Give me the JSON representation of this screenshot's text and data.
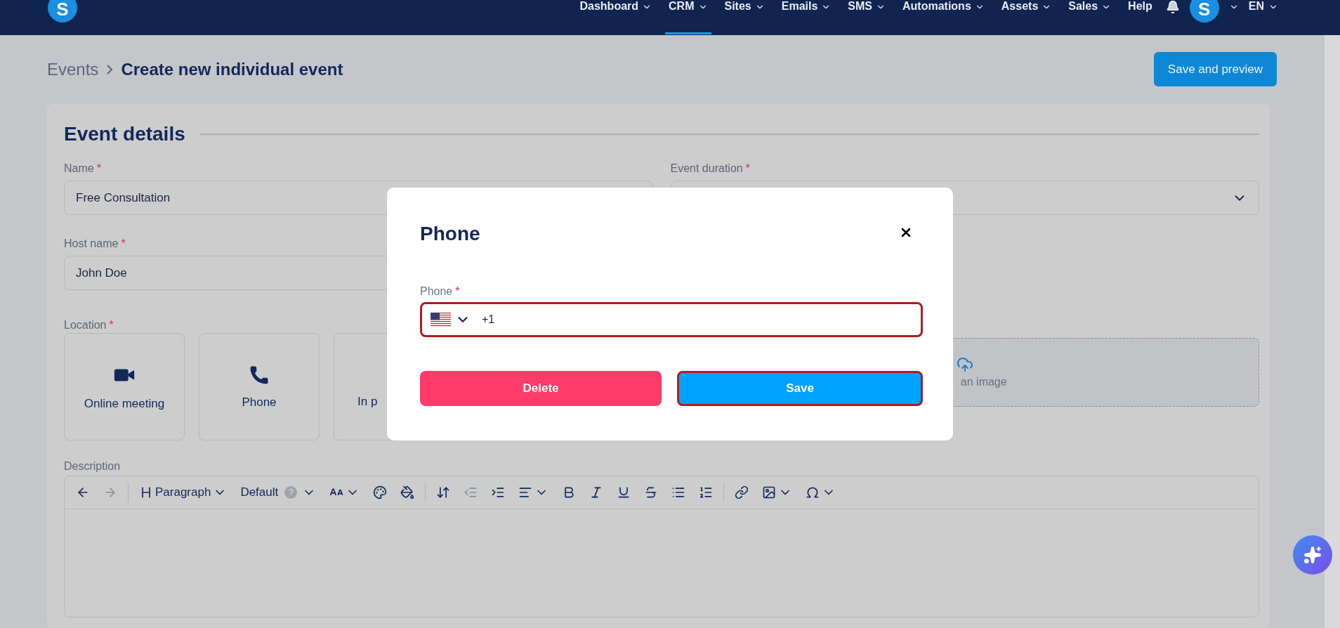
{
  "nav": {
    "logo": "S",
    "items": [
      {
        "label": "Dashboard",
        "selected": false,
        "dropdown": true
      },
      {
        "label": "CRM",
        "selected": true,
        "dropdown": true
      },
      {
        "label": "Sites",
        "selected": false,
        "dropdown": true
      },
      {
        "label": "Emails",
        "selected": false,
        "dropdown": true
      },
      {
        "label": "SMS",
        "selected": false,
        "dropdown": true
      },
      {
        "label": "Automations",
        "selected": false,
        "dropdown": true
      },
      {
        "label": "Assets",
        "selected": false,
        "dropdown": true
      },
      {
        "label": "Sales",
        "selected": false,
        "dropdown": true
      },
      {
        "label": "Help",
        "selected": false,
        "dropdown": false
      }
    ],
    "avatar": "S",
    "language": "EN"
  },
  "breadcrumb": {
    "parent": "Events",
    "current": "Create new individual event"
  },
  "save_preview_button": "Save and preview",
  "section_title": "Event details",
  "fields": [
    {
      "label": "Name",
      "required_mark": "*",
      "kind": "text",
      "value": "Free Consultation"
    },
    {
      "label": "Event duration",
      "required_mark": "*",
      "kind": "select"
    },
    {
      "label": "Host name",
      "required_mark": "*",
      "kind": "text",
      "value": "John Doe"
    }
  ],
  "location": {
    "label": "Location",
    "required_mark": "*",
    "options": [
      {
        "label": "Online meeting"
      },
      {
        "label": "Phone"
      },
      {
        "label": "In p"
      }
    ]
  },
  "image_upload": {
    "text": "an image"
  },
  "description": {
    "label": "Description",
    "toolbar": [
      {
        "kind": "icon",
        "disabled": false,
        "dropdown": false
      },
      {
        "kind": "icon",
        "disabled": true,
        "dropdown": false
      },
      {
        "kind": "divider"
      },
      {
        "kind": "text",
        "label": "Paragraph",
        "dropdown": true
      },
      {
        "kind": "text",
        "label": "Default",
        "badge": "?",
        "dropdown": true
      },
      {
        "kind": "icon",
        "disabled": false,
        "dropdown": true
      },
      {
        "kind": "icon",
        "disabled": false,
        "dropdown": false
      },
      {
        "kind": "icon",
        "disabled": false,
        "dropdown": false
      },
      {
        "kind": "divider"
      },
      {
        "kind": "icon",
        "disabled": false,
        "dropdown": false
      },
      {
        "kind": "icon",
        "disabled": true,
        "dropdown": false
      },
      {
        "kind": "icon",
        "disabled": false,
        "dropdown": false
      },
      {
        "kind": "icon",
        "disabled": false,
        "dropdown": true
      },
      {
        "kind": "icon",
        "disabled": false,
        "dropdown": false
      },
      {
        "kind": "icon",
        "disabled": false,
        "dropdown": false
      },
      {
        "kind": "icon",
        "disabled": false,
        "dropdown": false
      },
      {
        "kind": "icon",
        "disabled": false,
        "dropdown": false
      },
      {
        "kind": "icon",
        "disabled": false,
        "dropdown": false
      },
      {
        "kind": "icon",
        "disabled": false,
        "dropdown": false
      },
      {
        "kind": "divider"
      },
      {
        "kind": "icon",
        "disabled": false,
        "dropdown": false
      },
      {
        "kind": "icon",
        "disabled": false,
        "dropdown": true
      },
      {
        "kind": "icon",
        "disabled": false,
        "dropdown": true
      }
    ]
  },
  "modal": {
    "title": "Phone",
    "field": {
      "label": "Phone",
      "required_mark": "*",
      "value": "+1",
      "highlighted": true
    },
    "buttons": [
      {
        "label": "Delete",
        "kind": "danger",
        "highlighted": false
      },
      {
        "label": "Save",
        "kind": "primary",
        "highlighted": true
      }
    ]
  }
}
